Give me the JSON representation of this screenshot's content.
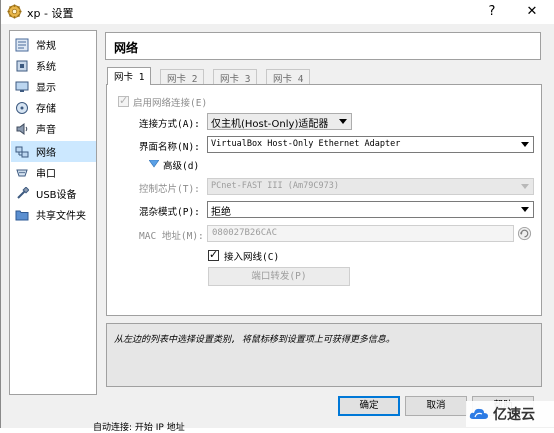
{
  "window": {
    "title": "xp - 设置",
    "help_label": "?",
    "close_label": "✕"
  },
  "sidebar": {
    "items": [
      {
        "label": "常规",
        "icon": "general-icon",
        "selected": false
      },
      {
        "label": "系统",
        "icon": "system-icon",
        "selected": false
      },
      {
        "label": "显示",
        "icon": "display-icon",
        "selected": false
      },
      {
        "label": "存储",
        "icon": "storage-icon",
        "selected": false
      },
      {
        "label": "声音",
        "icon": "audio-icon",
        "selected": false
      },
      {
        "label": "网络",
        "icon": "network-icon",
        "selected": true
      },
      {
        "label": "串口",
        "icon": "serial-port-icon",
        "selected": false
      },
      {
        "label": "USB设备",
        "icon": "usb-icon",
        "selected": false
      },
      {
        "label": "共享文件夹",
        "icon": "shared-folder-icon",
        "selected": false
      }
    ]
  },
  "header": {
    "title": "网络"
  },
  "tabs": [
    {
      "label": "网卡 1",
      "active": true
    },
    {
      "label": "网卡 2",
      "active": false
    },
    {
      "label": "网卡 3",
      "active": false
    },
    {
      "label": "网卡 4",
      "active": false
    }
  ],
  "adapter": {
    "enable_label": "启用网络连接(E)",
    "enable_checked": true,
    "attached_label": "连接方式(A):",
    "attached_value": "仅主机(Host-Only)适配器",
    "name_label": "界面名称(N):",
    "name_value": "VirtualBox Host-Only Ethernet Adapter",
    "advanced_label": "高级(d)",
    "chip_label": "控制芯片(T):",
    "chip_value": "PCnet-FAST III (Am79C973)",
    "promisc_label": "混杂模式(P):",
    "promisc_value": "拒绝",
    "mac_label": "MAC 地址(M):",
    "mac_value": "080027B26CAC",
    "cable_label": "接入网线(C)",
    "cable_checked": true,
    "port_forward_label": "端口转发(P)"
  },
  "info": {
    "text": "从左边的列表中选择设置类别, 将鼠标移到设置项上可获得更多信息。"
  },
  "footer": {
    "ok_label": "确定",
    "cancel_label": "取消",
    "help_label": "帮助"
  },
  "background": {
    "partial_text": "自动连接: 开始 IP 地址"
  },
  "watermark": {
    "text": "亿速云"
  },
  "colors": {
    "selection": "#cce8ff",
    "default_button_border": "#0078d7",
    "disabled_text": "#8c8c8c"
  }
}
